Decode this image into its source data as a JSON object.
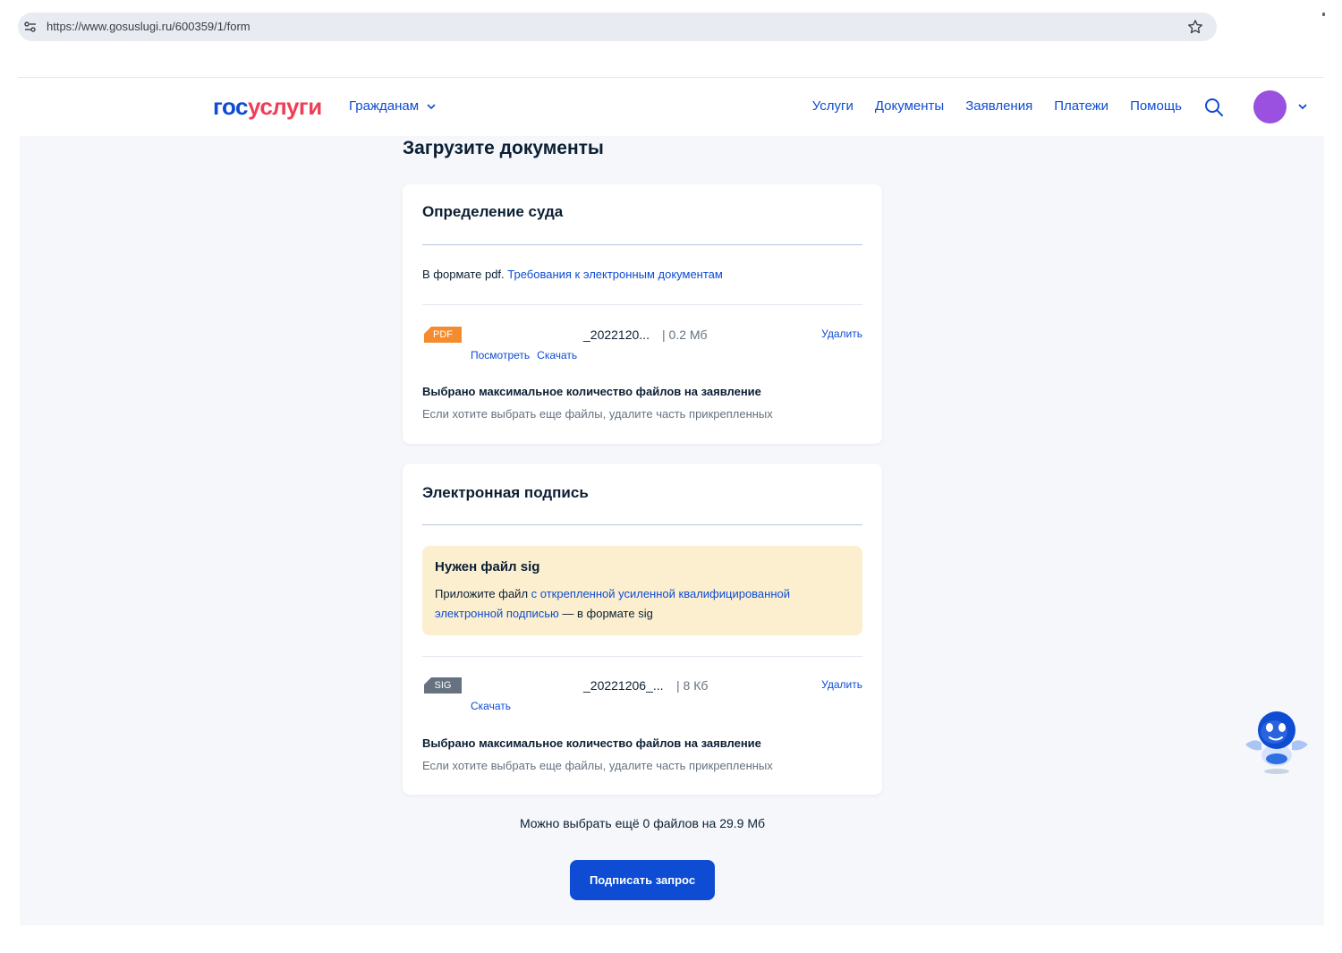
{
  "browser": {
    "url": "https://www.gosuslugi.ru/600359/1/form"
  },
  "header": {
    "logo_part1": "гос",
    "logo_part2": "услуги",
    "citizens_menu": "Гражданам",
    "nav": [
      "Услуги",
      "Документы",
      "Заявления",
      "Платежи",
      "Помощь"
    ]
  },
  "page": {
    "title": "Загрузите документы"
  },
  "court_card": {
    "title": "Определение суда",
    "format_text": "В формате pdf. ",
    "requirements_link": "Требования к электронным документам",
    "file": {
      "badge": "PDF",
      "name": "_2022120...",
      "size": "| 0.2 Мб",
      "delete": "Удалить",
      "view": "Посмотреть",
      "download": "Скачать"
    },
    "max_title": "Выбрано максимальное количество файлов на заявление",
    "max_hint": "Если хотите выбрать еще файлы, удалите часть прикрепленных"
  },
  "signature_card": {
    "title": "Электронная подпись",
    "notice_title": "Нужен файл sig",
    "notice_prefix": "Приложите файл ",
    "notice_link": "с открепленной усиленной квалифицированной электронной подписью",
    "notice_suffix": " — в формате sig",
    "file": {
      "badge": "SIG",
      "name": "_20221206_...",
      "size": "| 8 Кб",
      "delete": "Удалить",
      "download": "Скачать"
    },
    "max_title": "Выбрано максимальное количество файлов на заявление",
    "max_hint": "Если хотите выбрать еще файлы, удалите часть прикрепленных"
  },
  "footer": {
    "remaining": "Можно выбрать ещё 0 файлов на 29.9 Мб",
    "sign_button": "Подписать запрос"
  },
  "colors": {
    "brand_blue": "#0d4cd3",
    "brand_red": "#ee3f58",
    "pdf_badge": "#f48c2d",
    "sig_badge": "#66727f",
    "notice_bg": "#fcefd0",
    "avatar": "#9b51e0"
  },
  "icons": [
    "tune-icon",
    "star-icon",
    "chevron-down-icon",
    "search-icon",
    "avatar",
    "robot-assistant-icon"
  ]
}
